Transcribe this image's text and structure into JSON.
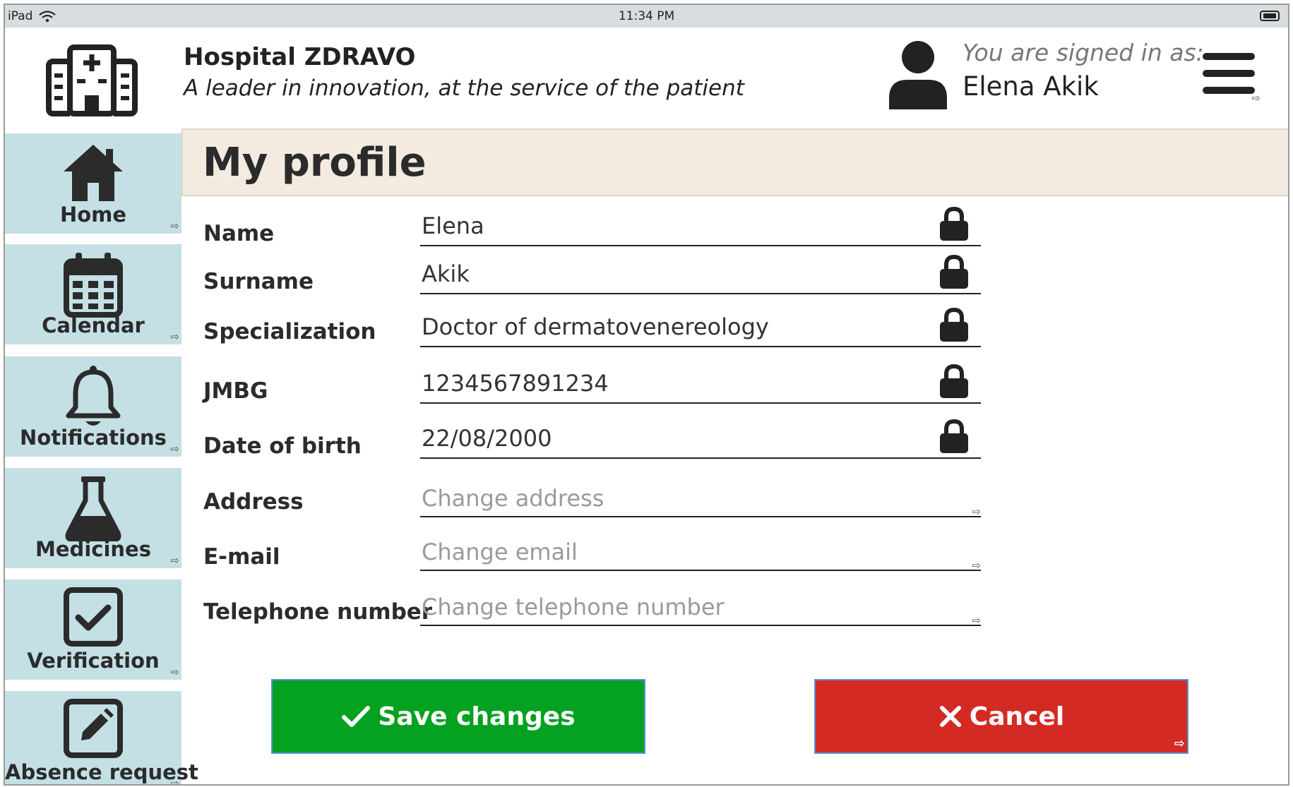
{
  "status_bar": {
    "device": "iPad",
    "time": "11:34 PM"
  },
  "header": {
    "hospital_name": "Hospital ZDRAVO",
    "tagline": "A leader in innovation, at the service of the patient",
    "signed_in_label": "You are signed in as:",
    "user_name": "Elena Akik"
  },
  "sidebar": {
    "items": [
      {
        "label": "Home",
        "icon": "home-icon"
      },
      {
        "label": "Calendar",
        "icon": "calendar-icon"
      },
      {
        "label": "Notifications",
        "icon": "bell-icon"
      },
      {
        "label": "Medicines",
        "icon": "flask-icon"
      },
      {
        "label": "Verification",
        "icon": "checkbox-icon"
      },
      {
        "label": "Absence request",
        "icon": "edit-icon"
      }
    ]
  },
  "page": {
    "title": "My profile"
  },
  "profile": {
    "name": {
      "label": "Name",
      "value": "Elena"
    },
    "surname": {
      "label": "Surname",
      "value": "Akik"
    },
    "specialization": {
      "label": "Specialization",
      "value": "Doctor of dermatovenereology"
    },
    "jmbg": {
      "label": "JMBG",
      "value": "1234567891234"
    },
    "dob": {
      "label": "Date of birth",
      "value": "22/08/2000"
    },
    "address": {
      "label": "Address",
      "value": "",
      "placeholder": "Change address"
    },
    "email": {
      "label": "E-mail",
      "value": "",
      "placeholder": "Change email"
    },
    "phone": {
      "label": "Telephone number",
      "value": "",
      "placeholder": "Change telephone number"
    }
  },
  "actions": {
    "save_label": "Save changes",
    "cancel_label": "Cancel"
  },
  "colors": {
    "sidebar_bg": "#c4e0e4",
    "title_bg": "#f3ebe0",
    "save": "#05a120",
    "cancel": "#d42a24"
  }
}
